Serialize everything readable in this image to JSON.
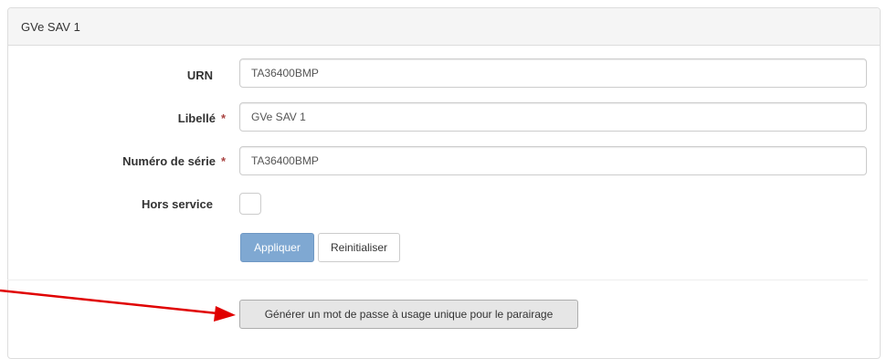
{
  "panel": {
    "title": "GVe SAV 1"
  },
  "form": {
    "urn": {
      "label": "URN",
      "value": "TA36400BMP"
    },
    "libelle": {
      "label": "Libellé",
      "required_mark": "*",
      "value": "GVe SAV 1"
    },
    "serial": {
      "label": "Numéro de série",
      "required_mark": "*",
      "value": "TA36400BMP"
    },
    "out_of_service": {
      "label": "Hors service",
      "checked": false
    },
    "apply_label": "Appliquer",
    "reset_label": "Reinitialiser",
    "generate_label": "Générer un mot de passe à usage unique pour le parairage"
  },
  "colors": {
    "annotation_arrow": "#e00000",
    "primary_button": "#7fa8d2",
    "required_mark": "#a94442"
  }
}
